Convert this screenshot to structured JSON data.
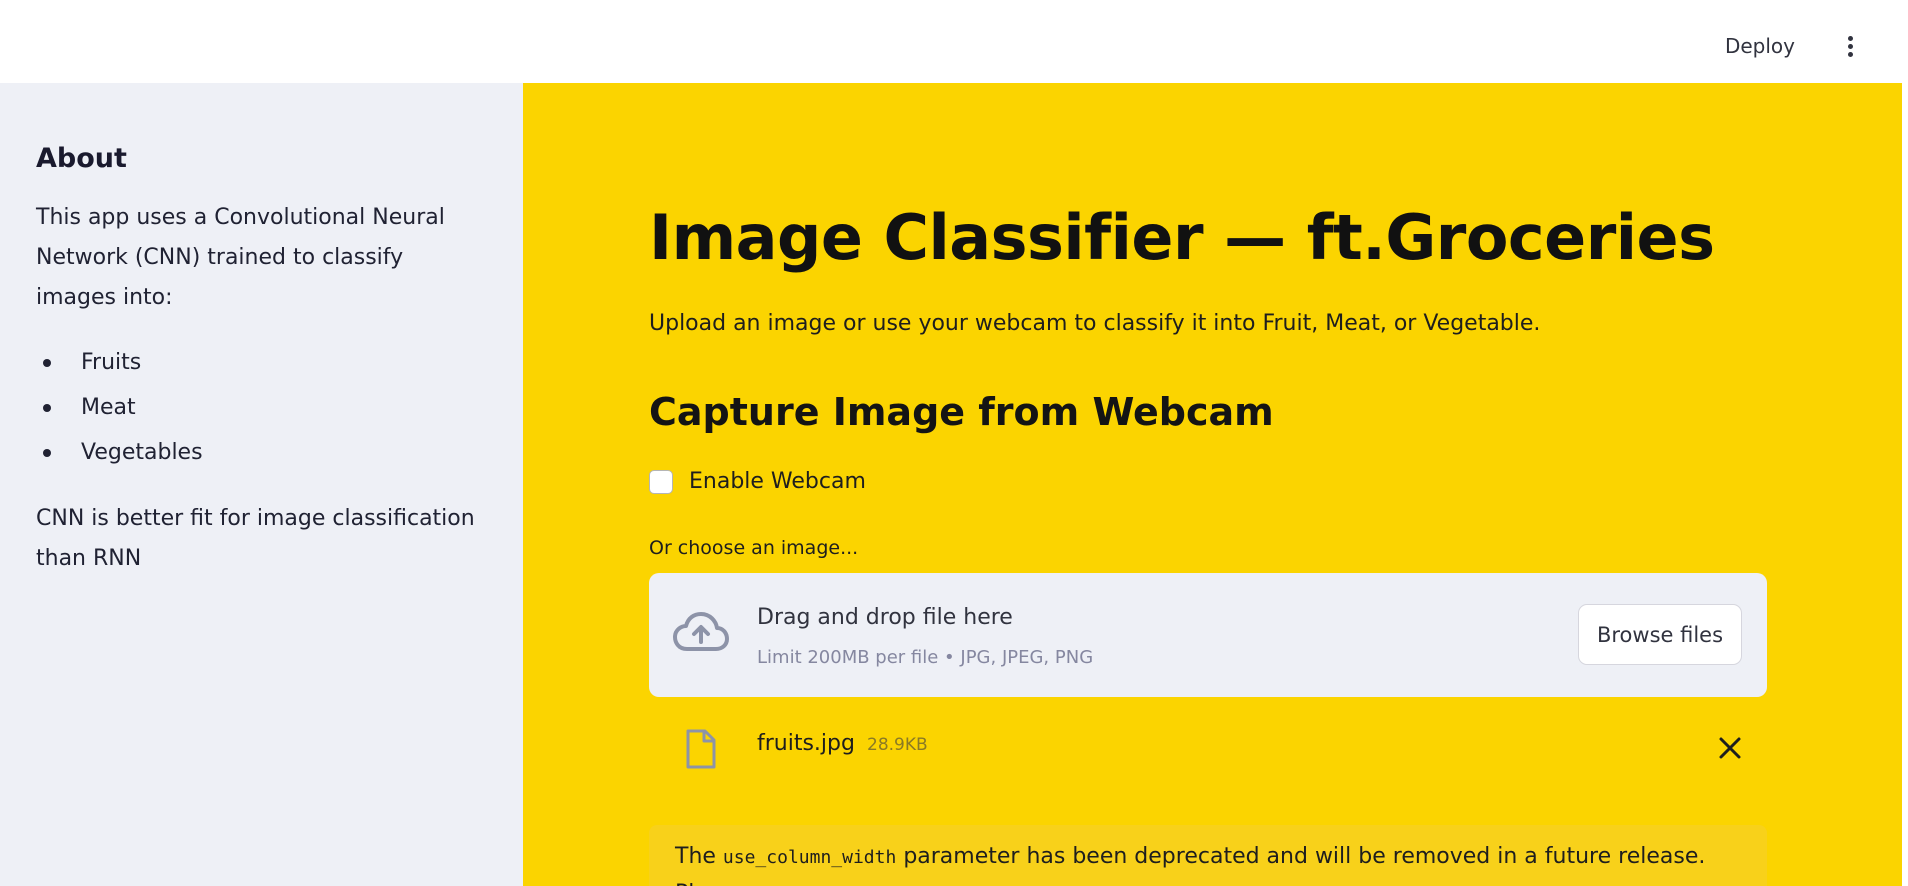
{
  "header": {
    "deploy_label": "Deploy",
    "menu_icon": "kebab-menu-icon"
  },
  "sidebar": {
    "heading": "About",
    "intro": "This app uses a Convolutional Neural Network (CNN) trained to classify images into:",
    "items": [
      {
        "label": "Fruits"
      },
      {
        "label": "Meat"
      },
      {
        "label": "Vegetables"
      }
    ],
    "note": "CNN is better fit for image classification than RNN"
  },
  "main": {
    "title": "Image Classifier — ft.Groceries",
    "subtitle": "Upload an image or use your webcam to classify it into Fruit, Meat, or Vegetable.",
    "webcam_heading": "Capture Image from Webcam",
    "webcam_checkbox_label": "Enable Webcam",
    "webcam_checked": false,
    "uploader_label": "Or choose an image...",
    "dropzone": {
      "icon": "cloud-upload-icon",
      "title": "Drag and drop file here",
      "limit": "Limit 200MB per file • JPG, JPEG, PNG",
      "browse_label": "Browse files"
    },
    "uploaded_file": {
      "icon": "file-icon",
      "name": "fruits.jpg",
      "size": "28.9KB",
      "remove_icon": "close-icon"
    },
    "notice": {
      "prefix": "The",
      "code": "use_column_width",
      "suffix": "parameter has been deprecated and will be removed in a future release. Please"
    }
  },
  "colors": {
    "main_background": "#fbd400",
    "sidebar_background": "#eef0f6",
    "dropzone_background": "#eef0f6"
  }
}
